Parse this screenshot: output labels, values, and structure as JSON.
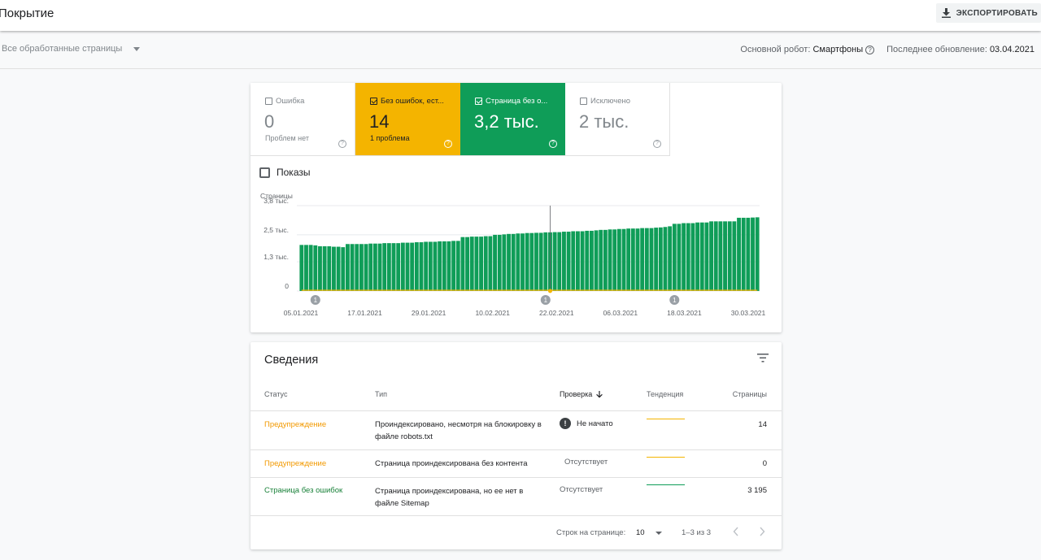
{
  "header": {
    "title": "Покрытие",
    "export_label": "ЭКСПОРТИРОВАТЬ"
  },
  "subheader": {
    "filter_value": "Все обработанные страницы",
    "crawler_label": "Основной робот:",
    "crawler_value": "Смартфоны",
    "updated_label": "Последнее обновление:",
    "updated_value": "03.04.2021"
  },
  "tiles": [
    {
      "label": "Ошибка",
      "value": "0",
      "sub": "Проблем нет",
      "checked": false
    },
    {
      "label": "Без ошибок, ест...",
      "value": "14",
      "sub": "1 проблема",
      "checked": true
    },
    {
      "label": "Страница без о...",
      "value": "3,2 тыс.",
      "sub": "",
      "checked": true
    },
    {
      "label": "Исключено",
      "value": "2 тыс.",
      "sub": "",
      "checked": false
    }
  ],
  "impressions_label": "Показы",
  "colors": {
    "valid": "#0f9d58",
    "warning": "#f4b400",
    "warning_text": "#f29900",
    "ok_text": "#188038"
  },
  "chart_data": {
    "type": "bar",
    "ylabel": "Страницы",
    "ylim": [
      0,
      3800
    ],
    "yticks": [
      {
        "value": 0,
        "label": "0"
      },
      {
        "value": 1300,
        "label": "1,3 тыс."
      },
      {
        "value": 2500,
        "label": "2,5 тыс."
      },
      {
        "value": 3800,
        "label": "3,8 тыс."
      }
    ],
    "xtick_labels": [
      "05.01.2021",
      "17.01.2021",
      "29.01.2021",
      "10.02.2021",
      "22.02.2021",
      "06.03.2021",
      "18.03.2021",
      "30.03.2021"
    ],
    "annotations": [
      {
        "label": "1",
        "index": 3
      },
      {
        "label": "1",
        "index": 53
      },
      {
        "label": "1",
        "index": 81
      }
    ],
    "series": [
      {
        "color": "#0f9d58",
        "values": [
          2050,
          2050,
          2050,
          2030,
          1990,
          1990,
          1990,
          1970,
          1970,
          1950,
          2090,
          2090,
          2090,
          2090,
          2090,
          2110,
          2110,
          2110,
          2130,
          2130,
          2130,
          2130,
          2150,
          2150,
          2150,
          2170,
          2170,
          2190,
          2190,
          2190,
          2210,
          2210,
          2210,
          2230,
          2230,
          2400,
          2400,
          2420,
          2420,
          2420,
          2440,
          2440,
          2500,
          2500,
          2520,
          2540,
          2540,
          2560,
          2560,
          2580,
          2580,
          2590,
          2590,
          2610,
          2610,
          2620,
          2620,
          2640,
          2640,
          2660,
          2660,
          2660,
          2680,
          2680,
          2700,
          2720,
          2720,
          2740,
          2740,
          2760,
          2760,
          2780,
          2780,
          2780,
          2800,
          2800,
          2800,
          2820,
          2830,
          2850,
          2880,
          2990,
          2990,
          3020,
          3020,
          3020,
          3050,
          3050,
          3050,
          3100,
          3100,
          3100,
          3100,
          3100,
          3100,
          3260,
          3260,
          3260,
          3270,
          3280
        ]
      },
      {
        "color": "#f4b400",
        "values": [
          14,
          14,
          14,
          14,
          14,
          14,
          14,
          14,
          14,
          14,
          14,
          14,
          14,
          14,
          14,
          14,
          14,
          14,
          14,
          14,
          14,
          14,
          14,
          14,
          14,
          14,
          14,
          14,
          14,
          14,
          14,
          14,
          14,
          14,
          14,
          14,
          14,
          14,
          14,
          14,
          14,
          14,
          14,
          14,
          14,
          14,
          14,
          14,
          14,
          14,
          14,
          14,
          14,
          14,
          14,
          14,
          14,
          14,
          14,
          14,
          14,
          14,
          14,
          14,
          14,
          14,
          14,
          14,
          14,
          14,
          14,
          14,
          14,
          14,
          14,
          14,
          14,
          14,
          14,
          14,
          14,
          14,
          14,
          14,
          14,
          14,
          14,
          14,
          14,
          14,
          14,
          14,
          14,
          14,
          14,
          14,
          14,
          14,
          14,
          14
        ]
      }
    ]
  },
  "details": {
    "title": "Сведения",
    "columns": {
      "status": "Статус",
      "type": "Тип",
      "check": "Проверка",
      "trend": "Тенденция",
      "pages": "Страницы"
    },
    "rows": [
      {
        "status": "Предупреждение",
        "type": "Проиндексировано, несмотря на блокировку в файле robots.txt",
        "check": "Не начато",
        "pages": "14",
        "tone": "warn"
      },
      {
        "status": "Предупреждение",
        "type": "Страница проиндексирована без контента",
        "check": "Отсутствует",
        "pages": "0",
        "tone": "warn"
      },
      {
        "status": "Страница без ошибок",
        "type": "Страница проиндексирована, но ее нет в файле Sitemap",
        "check": "Отсутствует",
        "pages": "3 195",
        "tone": "ok"
      }
    ],
    "pagination": {
      "rows_label": "Строк на странице:",
      "rows_value": "10",
      "range": "1–3 из 3"
    }
  }
}
